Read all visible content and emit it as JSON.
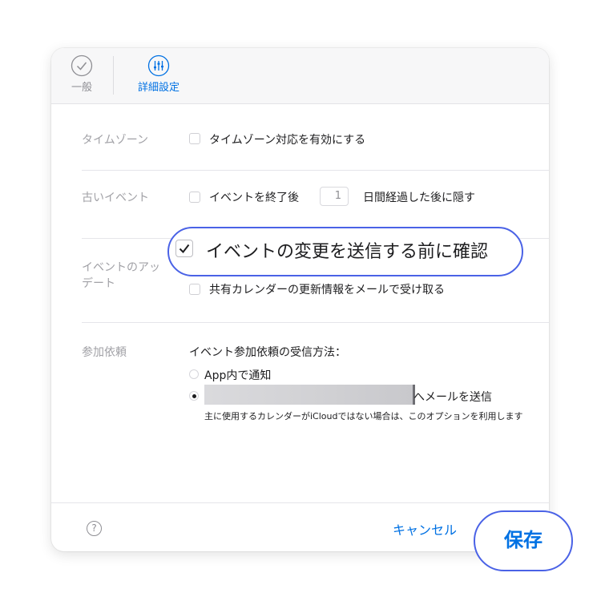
{
  "tabs": {
    "general": "一般",
    "advanced": "詳細設定"
  },
  "timezone": {
    "label": "タイムゾーン",
    "option": "タイムゾーン対応を有効にする"
  },
  "old_events": {
    "label": "古いイベント",
    "prefix": "イベントを終了後",
    "days_value": "1",
    "suffix": "日間経過した後に隠す"
  },
  "event_updates": {
    "label": "イベントのアップデート",
    "label_line1": "イベントのアッ",
    "label_line2": "デート",
    "confirm_option": "イベントの変更を送信する前に確認",
    "confirm_checked": true,
    "shared_option": "共有カレンダーの更新情報をメールで受け取る"
  },
  "invitations": {
    "label": "参加依頼",
    "heading": "イベント参加依頼の受信方法：",
    "option_app": "App内で通知",
    "option_email_suffix": "へメールを送信",
    "note": "主に使用するカレンダーがiCloudではない場合は、このオプションを利用します"
  },
  "footer": {
    "help": "?",
    "cancel": "キャンセル",
    "save": "保存"
  },
  "colors": {
    "accent": "#0071e3",
    "highlight": "#4a62e6"
  }
}
